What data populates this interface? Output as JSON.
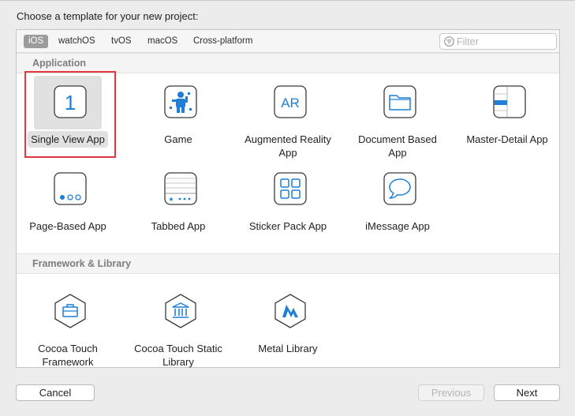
{
  "dialog": {
    "heading": "Choose a template for your new project:"
  },
  "platform_tabs": [
    {
      "label": "iOS",
      "selected": true
    },
    {
      "label": "watchOS",
      "selected": false
    },
    {
      "label": "tvOS",
      "selected": false
    },
    {
      "label": "macOS",
      "selected": false
    },
    {
      "label": "Cross-platform",
      "selected": false
    }
  ],
  "filter": {
    "placeholder": "Filter",
    "value": ""
  },
  "sections": [
    {
      "title": "Application",
      "templates": [
        {
          "label": "Single View App",
          "icon": "single-view-icon",
          "selected": true
        },
        {
          "label": "Game",
          "icon": "game-icon",
          "selected": false
        },
        {
          "label": "Augmented Reality App",
          "icon": "ar-icon",
          "selected": false
        },
        {
          "label": "Document Based App",
          "icon": "folder-icon",
          "selected": false
        },
        {
          "label": "Master-Detail App",
          "icon": "master-detail-icon",
          "selected": false
        },
        {
          "label": "Page-Based App",
          "icon": "page-based-icon",
          "selected": false
        },
        {
          "label": "Tabbed App",
          "icon": "tabbed-icon",
          "selected": false
        },
        {
          "label": "Sticker Pack App",
          "icon": "sticker-pack-icon",
          "selected": false
        },
        {
          "label": "iMessage App",
          "icon": "message-bubble-icon",
          "selected": false
        }
      ]
    },
    {
      "title": "Framework & Library",
      "templates": [
        {
          "label": "Cocoa Touch Framework",
          "icon": "toolbox-icon",
          "selected": false
        },
        {
          "label": "Cocoa Touch Static Library",
          "icon": "library-building-icon",
          "selected": false
        },
        {
          "label": "Metal Library",
          "icon": "metal-icon",
          "selected": false
        }
      ]
    }
  ],
  "buttons": {
    "cancel": "Cancel",
    "previous": "Previous",
    "next": "Next"
  },
  "colors": {
    "selection_outline": "#e0383e",
    "tab_selected": "#9b9b9b",
    "icon_blue": "#1f7fd6"
  }
}
